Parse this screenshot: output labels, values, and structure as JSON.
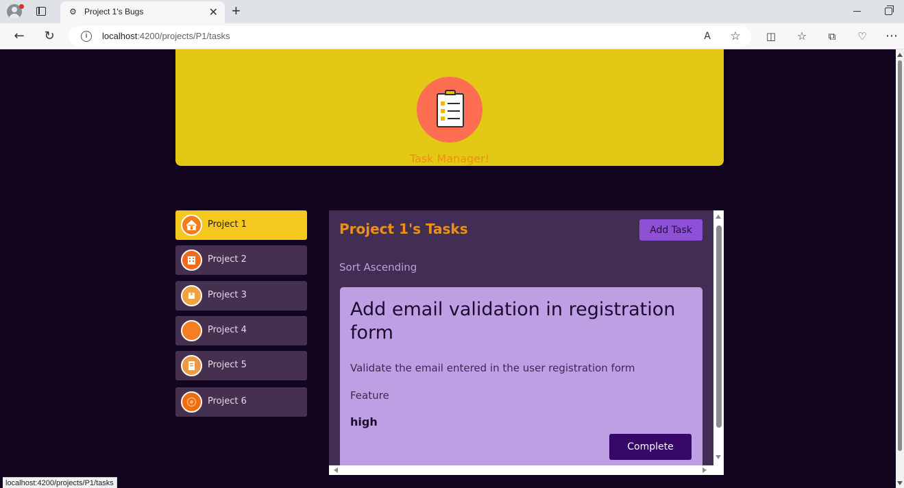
{
  "browser": {
    "tab_title": "Project 1's Bugs",
    "tab_close": "✕",
    "new_tab": "+",
    "url_host": "localhost",
    "url_path": ":4200/projects/P1/tasks",
    "status_url": "localhost:4200/projects/P1/tasks"
  },
  "hero": {
    "title": "Task Manager!"
  },
  "sidebar": {
    "items": [
      {
        "label": "Project 1",
        "active": true,
        "icon": "house-icon",
        "color": "#f27d1a"
      },
      {
        "label": "Project 2",
        "active": false,
        "icon": "building-icon",
        "color": "#f26a1a"
      },
      {
        "label": "Project 3",
        "active": false,
        "icon": "box-icon",
        "color": "#f0a240"
      },
      {
        "label": "Project 4",
        "active": false,
        "icon": "circle-icon",
        "color": "#f57d22"
      },
      {
        "label": "Project 5",
        "active": false,
        "icon": "document-icon",
        "color": "#e89b40"
      },
      {
        "label": "Project 6",
        "active": false,
        "icon": "target-icon",
        "color": "#ef6d0e"
      }
    ]
  },
  "tasks_panel": {
    "title": "Project 1's Tasks",
    "add_button": "Add Task",
    "sort_label": "Sort Ascending",
    "task": {
      "title": "Add email validation in registration form",
      "description": "Validate the email entered in the user registration form",
      "type": "Feature",
      "priority": "high",
      "complete_button": "Complete"
    }
  },
  "colors": {
    "hero_bg": "#e3c816",
    "accent": "#ee8f15",
    "panel_bg": "#422d55",
    "card_bg": "#bf9fe4",
    "button_purple": "#8e50d6",
    "complete_bg": "#370869"
  }
}
